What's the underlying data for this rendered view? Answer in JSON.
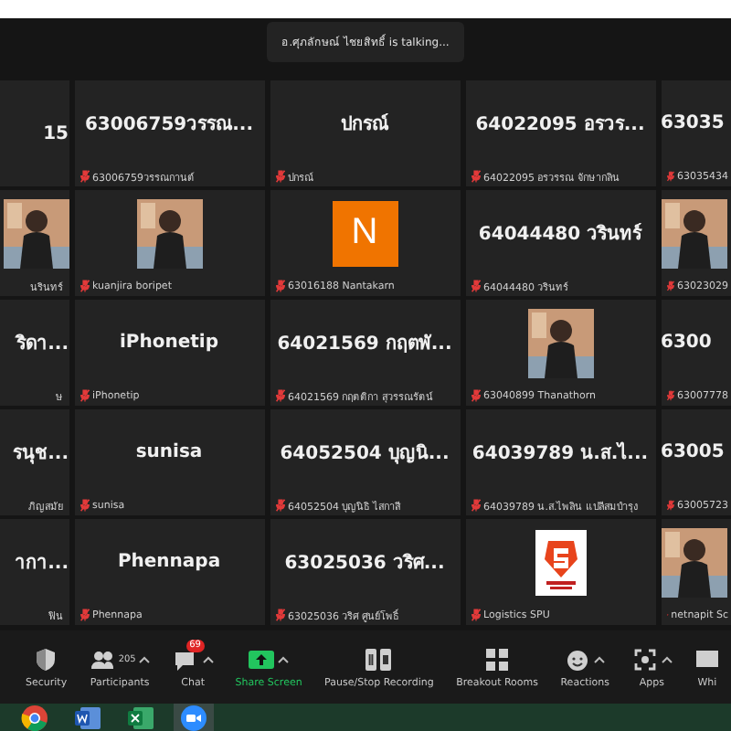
{
  "banner": {
    "text": "อ.ศุภลักษณ์ ไชยสิทธิ์ is talking..."
  },
  "tiles": [
    {
      "kind": "name",
      "display": "15",
      "muted": false
    },
    {
      "kind": "name",
      "display": "63006759วรรณ...",
      "footer": "63006759วรรณกานต์",
      "muted": true
    },
    {
      "kind": "name",
      "display": "ปกรณ์",
      "footer": "ปกรณ์",
      "muted": true
    },
    {
      "kind": "name",
      "display": "64022095 อรวร...",
      "footer": "64022095 อรวรรณ จักษากลิน",
      "muted": true
    },
    {
      "kind": "name",
      "display": "63035",
      "footer": "63035434",
      "muted": true
    },
    {
      "footer": "นรินทร์",
      "muted": false
    },
    {
      "footer": "kuanjira boripet",
      "muted": true
    },
    {
      "kind": "letter",
      "display": "N",
      "footer": "63016188 Nantakarn",
      "muted": true
    },
    {
      "kind": "name",
      "display": "64044480 วรินทร์",
      "footer": "64044480 วรินทร์",
      "muted": true
    },
    {
      "footer": "63023029",
      "muted": true
    },
    {
      "kind": "name",
      "display": "ริดา...",
      "footer": "ษ",
      "muted": false
    },
    {
      "kind": "name",
      "display": "iPhonetip",
      "footer": "iPhonetip",
      "muted": true
    },
    {
      "kind": "name",
      "display": "64021569 กฤตพั...",
      "footer": "64021569 กฤตติกา สุวรรณรัตน์",
      "muted": true
    },
    {
      "footer": "63040899 Thanathorn",
      "muted": true
    },
    {
      "kind": "name",
      "display": "6300",
      "footer": "63007778",
      "muted": true
    },
    {
      "kind": "name",
      "display": "รนุช...",
      "footer": "ภิญสมัย",
      "muted": false
    },
    {
      "kind": "name",
      "display": "sunisa",
      "footer": "sunisa",
      "muted": true
    },
    {
      "kind": "name",
      "display": "64052504 บุญนิ...",
      "footer": "64052504 บุญนิธิ ไสกาสี",
      "muted": true
    },
    {
      "kind": "name",
      "display": "64039789 น.ส.ไ...",
      "footer": "64039789 น.ส.ไพลิน แปลีสมบำรุง",
      "muted": true
    },
    {
      "kind": "name",
      "display": "63005",
      "footer": "63005723",
      "muted": true
    },
    {
      "kind": "name",
      "display": "ากา...",
      "footer": "ฟิน",
      "muted": false
    },
    {
      "kind": "name",
      "display": "Phennapa",
      "footer": "Phennapa",
      "muted": true
    },
    {
      "kind": "name",
      "display": "63025036 วริศ...",
      "footer": "63025036 วริศ ศูนย์โพธิ์",
      "muted": true
    },
    {
      "kind": "logo",
      "footer": "Logistics SPU",
      "muted": true
    },
    {
      "footer": "netnapit Sc",
      "muted": true
    }
  ],
  "toolbar": [
    {
      "kind": "security",
      "label": "Security",
      "caret": false
    },
    {
      "kind": "participants",
      "label": "Participants",
      "count": "205",
      "caret": true
    },
    {
      "kind": "chat",
      "label": "Chat",
      "badge": "69",
      "caret": true
    },
    {
      "kind": "share",
      "label": "Share Screen",
      "caret": true
    },
    {
      "kind": "record",
      "label": "Pause/Stop Recording",
      "caret": false
    },
    {
      "kind": "breakout",
      "label": "Breakout Rooms",
      "caret": false
    },
    {
      "kind": "reactions",
      "label": "Reactions",
      "caret": true
    },
    {
      "kind": "apps",
      "label": "Apps",
      "caret": true
    },
    {
      "kind": "whiteboard",
      "label": "Whi",
      "caret": false
    }
  ],
  "taskbar": [
    {
      "kind": "chrome",
      "selected": false
    },
    {
      "kind": "word",
      "selected": false
    },
    {
      "kind": "excel",
      "selected": false
    },
    {
      "kind": "zoom",
      "selected": true
    }
  ]
}
